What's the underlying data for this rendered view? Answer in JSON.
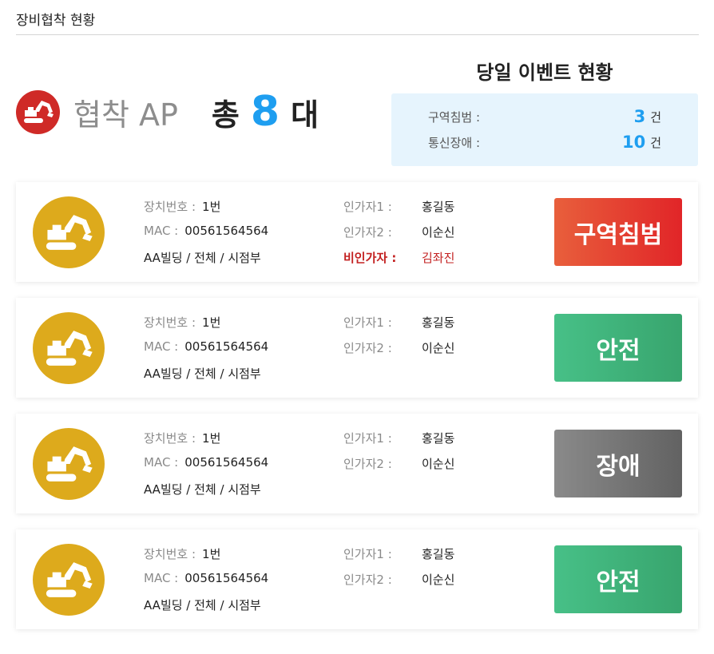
{
  "page": {
    "title": "장비협착 현황"
  },
  "summary": {
    "label": "협착 AP",
    "total_prefix": "총",
    "total_count": "8",
    "total_suffix": "대",
    "icon": "excavator-icon"
  },
  "events": {
    "title": "당일 이벤트 현황",
    "rows": [
      {
        "label": "구역침범 :",
        "count": "3",
        "unit": "건"
      },
      {
        "label": "통신장애 :",
        "count": "10",
        "unit": "건"
      }
    ]
  },
  "colors": {
    "accent_blue": "#1e9ef0",
    "summary_icon_bg": "#cf2a27",
    "device_icon_bg": "#ddaa1c",
    "status_intrusion": "#e8312c",
    "status_safe": "#3fb57c",
    "status_fault": "#7a7a7a",
    "unauthorized_text": "#c32121"
  },
  "devices": [
    {
      "device_label": "장치번호 :",
      "device_no": "1번",
      "mac_label": "MAC :",
      "mac": "00561564564",
      "location": "AA빌딩 / 전체 / 시점부",
      "auth1_label": "인가자1 :",
      "auth1": "홍길동",
      "auth2_label": "인가자2 :",
      "auth2": "이순신",
      "unauth_label": "비인가자 :",
      "unauth": "김좌진",
      "status": "구역침범",
      "status_type": "intrusion"
    },
    {
      "device_label": "장치번호 :",
      "device_no": "1번",
      "mac_label": "MAC :",
      "mac": "00561564564",
      "location": "AA빌딩 / 전체 / 시점부",
      "auth1_label": "인가자1 :",
      "auth1": "홍길동",
      "auth2_label": "인가자2 :",
      "auth2": "이순신",
      "status": "안전",
      "status_type": "safe"
    },
    {
      "device_label": "장치번호 :",
      "device_no": "1번",
      "mac_label": "MAC :",
      "mac": "00561564564",
      "location": "AA빌딩 / 전체 / 시점부",
      "auth1_label": "인가자1 :",
      "auth1": "홍길동",
      "auth2_label": "인가자2 :",
      "auth2": "이순신",
      "status": "장애",
      "status_type": "fault"
    },
    {
      "device_label": "장치번호 :",
      "device_no": "1번",
      "mac_label": "MAC :",
      "mac": "00561564564",
      "location": "AA빌딩 / 전체 / 시점부",
      "auth1_label": "인가자1 :",
      "auth1": "홍길동",
      "auth2_label": "인가자2 :",
      "auth2": "이순신",
      "status": "안전",
      "status_type": "safe"
    }
  ]
}
